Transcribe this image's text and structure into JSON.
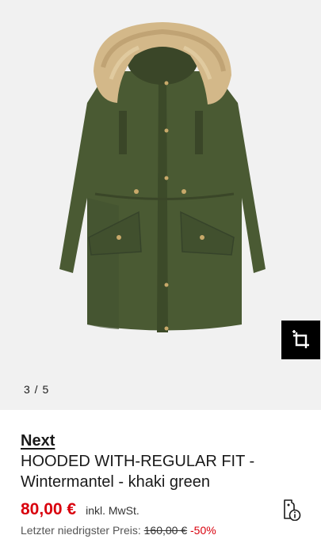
{
  "gallery": {
    "counter": "3 / 5",
    "image_alt": "Khaki green hooded parka with faux fur trim"
  },
  "product": {
    "brand": "Next",
    "title": "HOODED WITH-REGULAR FIT - Wintermantel - khaki green",
    "price": "80,00 €",
    "vat_note": "inkl. MwSt.",
    "lowest_price_label": "Letzter niedrigster Preis:",
    "original_price": "160,00 €",
    "discount": "-50%"
  },
  "icons": {
    "crop": "crop-icon",
    "tag": "price-tag-info-icon"
  },
  "colors": {
    "price_red": "#d9000d",
    "coat_green": "#4a5a33",
    "fur": "#d3b889",
    "background": "#f1f1f1"
  }
}
